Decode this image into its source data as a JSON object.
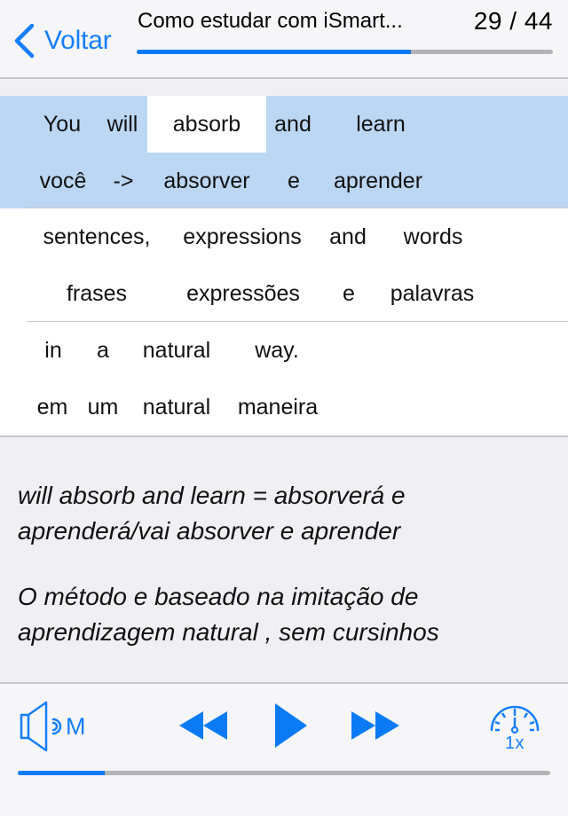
{
  "header": {
    "back_label": "Voltar",
    "lesson_title": "Como estudar com iSmart...",
    "lesson_counter": "29 / 44",
    "lesson_current": 29,
    "lesson_total": 44,
    "lesson_progress": 0.659
  },
  "sentences": [
    {
      "active": true,
      "english": [
        "You",
        "will",
        "absorb",
        "and",
        "learn"
      ],
      "current_word_index": 2,
      "portuguese": [
        "você",
        "->",
        "absorver",
        "e",
        "aprender"
      ]
    },
    {
      "active": false,
      "english": [
        "sentences,",
        "expressions",
        "and",
        "words"
      ],
      "portuguese": [
        "frases",
        "expressões",
        "e",
        "palavras"
      ]
    },
    {
      "active": false,
      "english": [
        "in",
        "a",
        "natural",
        "way."
      ],
      "portuguese": [
        "em",
        "um",
        "natural",
        "maneira"
      ]
    }
  ],
  "notes": [
    "will absorb and learn = absorverá e aprenderá/vai absorver e aprender",
    "O método e baseado na imitação de aprendizagem natural , sem cursinhos"
  ],
  "player": {
    "volume_icon": "speaker-icon",
    "volume_label": "M",
    "rewind_icon": "rewind-icon",
    "play_icon": "play-icon",
    "forward_icon": "fast-forward-icon",
    "speed_icon": "speedometer-icon",
    "speed_label": "1x",
    "audio_progress": 0.163
  },
  "colors": {
    "accent": "#157efb",
    "active_row": "#bcd7f4",
    "current_word": "#ffffff",
    "progress_track": "#b4b4b4"
  }
}
